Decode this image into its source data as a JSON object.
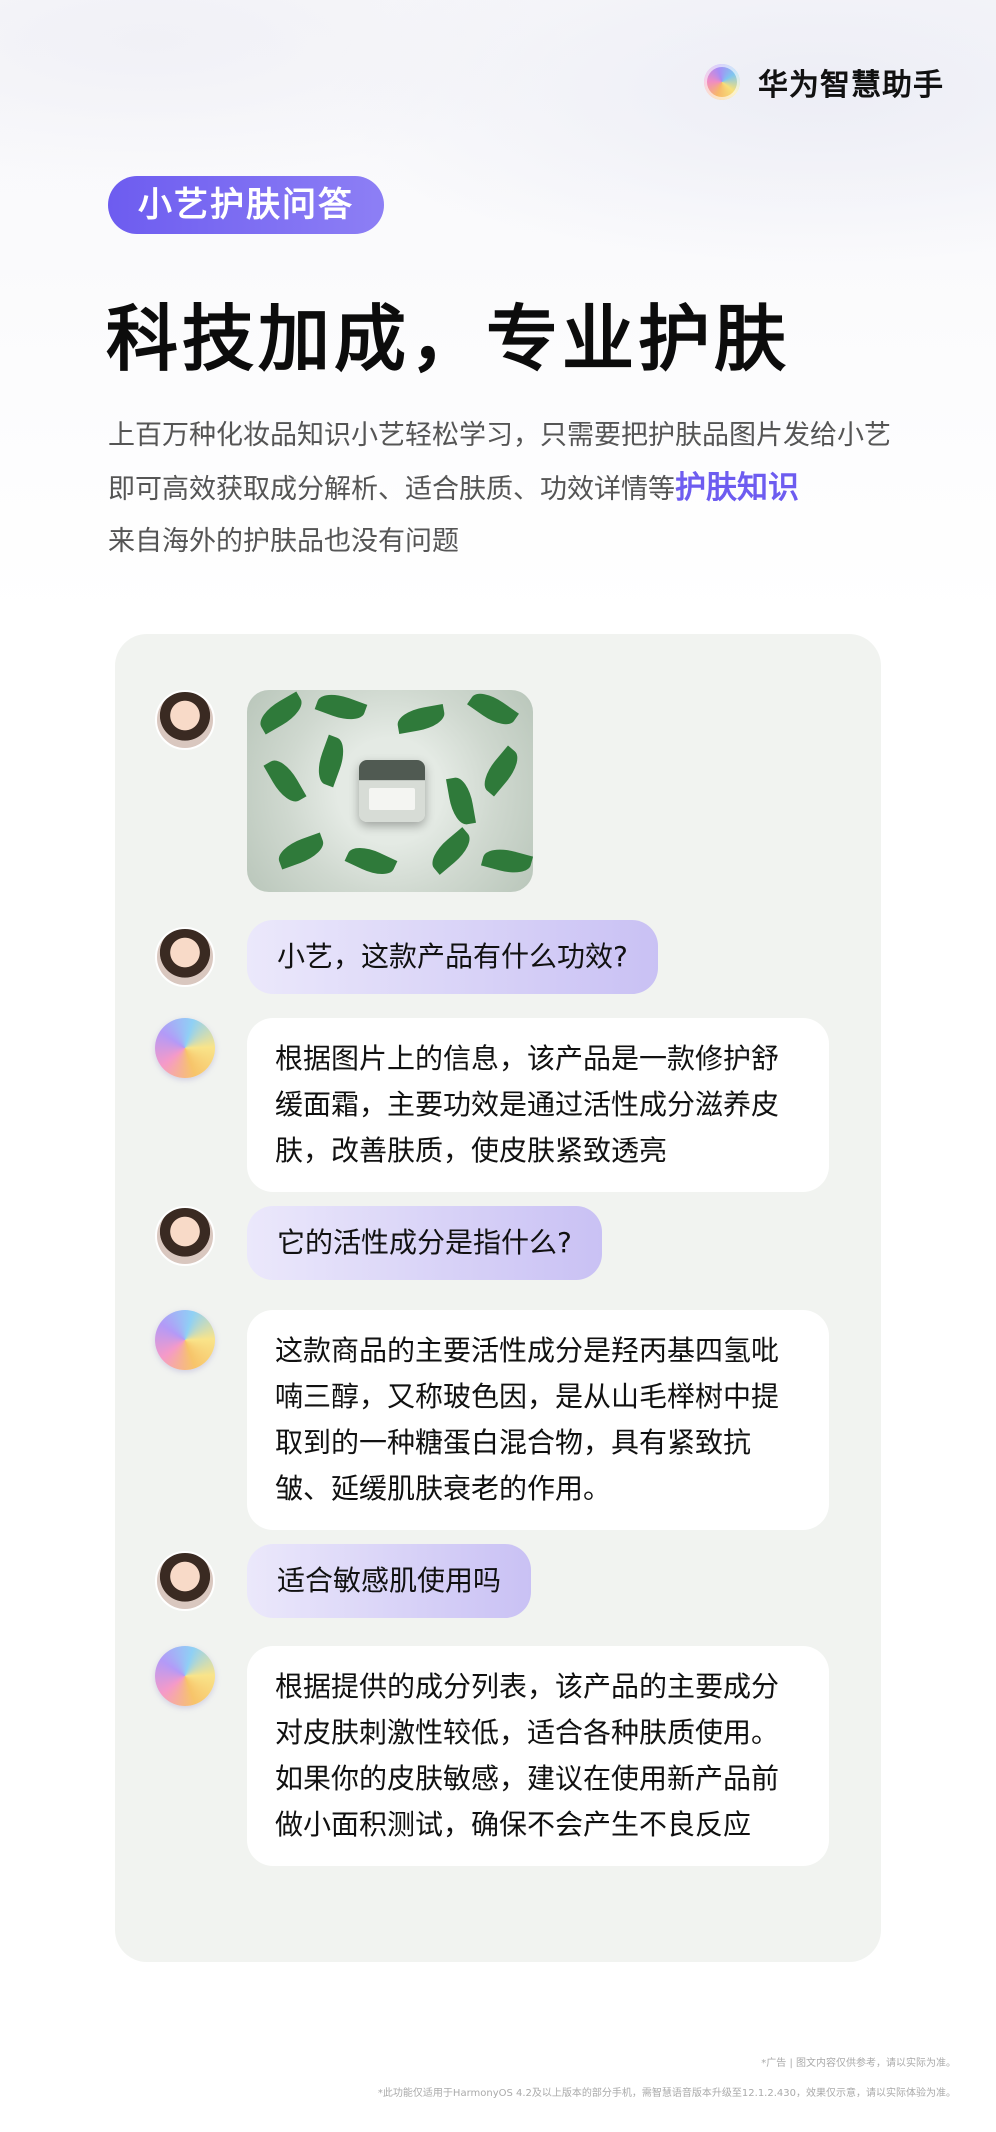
{
  "brand": {
    "name": "华为智慧助手",
    "icon": "assistant-logo-icon"
  },
  "tag": "小艺护肤问答",
  "headline": "科技加成，专业护肤",
  "description": {
    "line1": "上百万种化妆品知识小艺轻松学习，只需要把护肤品图片发给小艺",
    "line2_prefix": "即可高效获取成分解析、适合肤质、功效详情等",
    "line2_highlight": "护肤知识",
    "line3": "来自海外的护肤品也没有问题"
  },
  "colors": {
    "accent": "#6d5cf0",
    "card_bg": "#f1f3f0",
    "user_bubble": "#c9c1f4"
  },
  "chat": {
    "messages": [
      {
        "role": "user",
        "type": "image",
        "icon": "skincare-product-photo"
      },
      {
        "role": "user",
        "text": "小艺，这款产品有什么功效?"
      },
      {
        "role": "assistant",
        "text": "根据图片上的信息，该产品是一款修护舒缓面霜，主要功效是通过活性成分滋养皮肤，改善肤质，使皮肤紧致透亮"
      },
      {
        "role": "user",
        "text": "它的活性成分是指什么?"
      },
      {
        "role": "assistant",
        "text": "这款商品的主要活性成分是羟丙基四氢吡喃三醇，又称玻色因，是从山毛榉树中提取到的一种糖蛋白混合物，具有紧致抗皱、延缓肌肤衰老的作用。"
      },
      {
        "role": "user",
        "text": "适合敏感肌使用吗"
      },
      {
        "role": "assistant",
        "text": "根据提供的成分列表，该产品的主要成分对皮肤刺激性较低，适合各种肤质使用。如果你的皮肤敏感，建议在使用新产品前做小面积测试，确保不会产生不良反应"
      }
    ]
  },
  "footer": {
    "note1": "*广告 | 图文内容仅供参考，请以实际为准。",
    "note2": "*此功能仅适用于HarmonyOS 4.2及以上版本的部分手机，需智慧语音版本升级至12.1.2.430，效果仅示意，请以实际体验为准。"
  }
}
